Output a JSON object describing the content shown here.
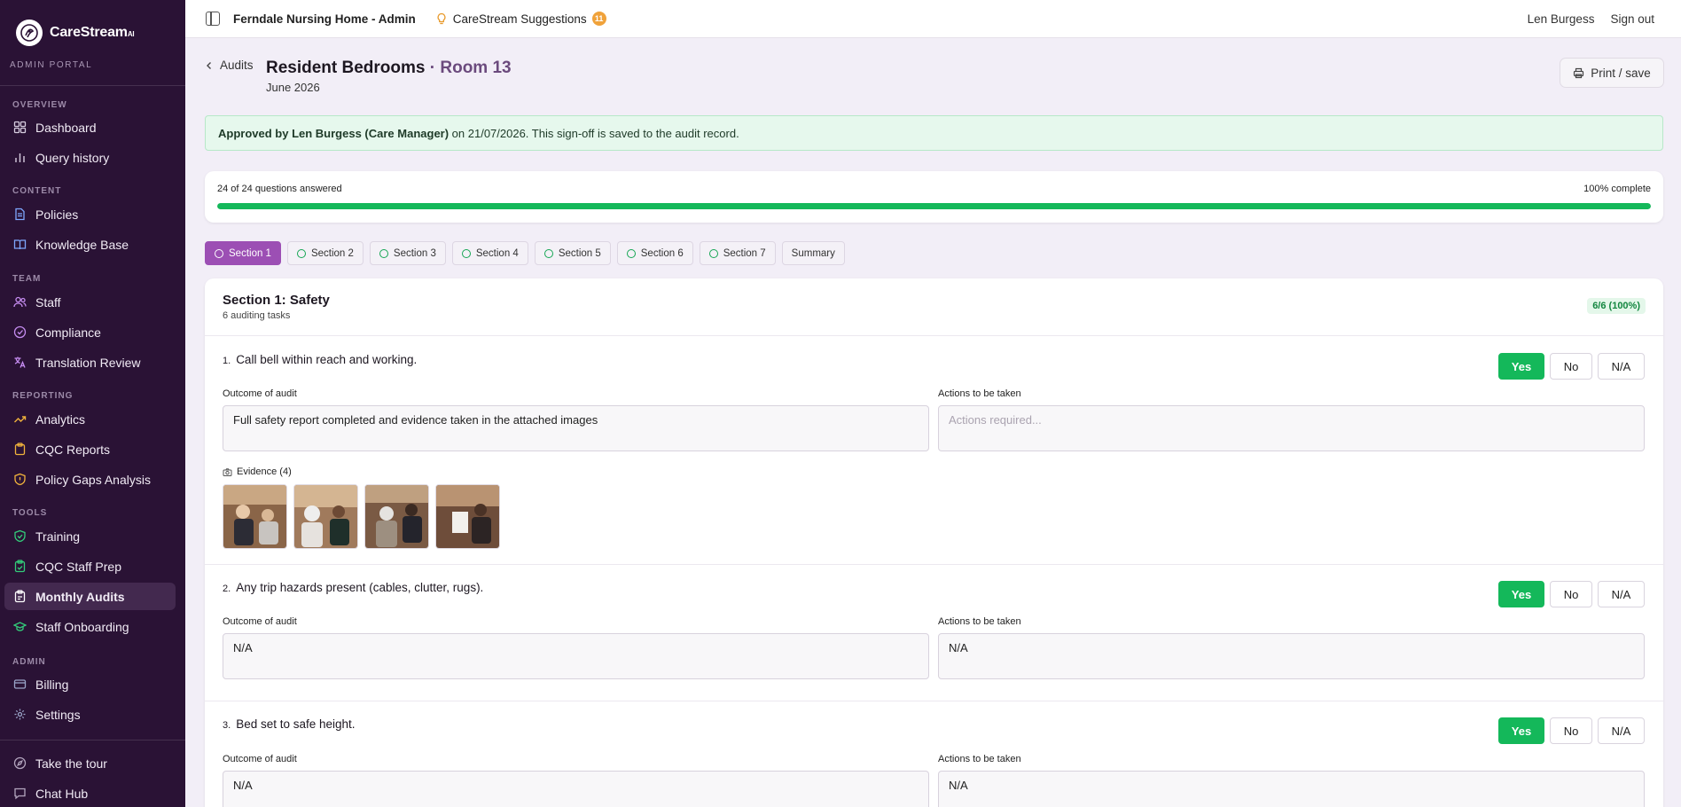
{
  "brand": {
    "name": "CareStream",
    "suffix": "AI",
    "portal": "ADMIN PORTAL"
  },
  "sidebar": {
    "sections": [
      {
        "label": "OVERVIEW",
        "items": [
          {
            "label": "Dashboard",
            "icon": "dashboard-icon"
          },
          {
            "label": "Query history",
            "icon": "bar-chart-icon"
          }
        ]
      },
      {
        "label": "CONTENT",
        "items": [
          {
            "label": "Policies",
            "icon": "document-icon"
          },
          {
            "label": "Knowledge Base",
            "icon": "book-icon"
          }
        ]
      },
      {
        "label": "TEAM",
        "items": [
          {
            "label": "Staff",
            "icon": "users-icon"
          },
          {
            "label": "Compliance",
            "icon": "check-circle-icon"
          },
          {
            "label": "Translation Review",
            "icon": "translate-icon"
          }
        ]
      },
      {
        "label": "REPORTING",
        "items": [
          {
            "label": "Analytics",
            "icon": "trend-icon"
          },
          {
            "label": "CQC Reports",
            "icon": "clipboard-icon"
          },
          {
            "label": "Policy Gaps Analysis",
            "icon": "warning-shield-icon"
          }
        ]
      },
      {
        "label": "TOOLS",
        "items": [
          {
            "label": "Training",
            "icon": "shield-check-icon"
          },
          {
            "label": "CQC Staff Prep",
            "icon": "clipboard-check-icon"
          },
          {
            "label": "Monthly Audits",
            "icon": "clipboard-list-icon",
            "active": true
          },
          {
            "label": "Staff Onboarding",
            "icon": "graduation-cap-icon"
          }
        ]
      },
      {
        "label": "ADMIN",
        "items": [
          {
            "label": "Billing",
            "icon": "credit-card-icon"
          },
          {
            "label": "Settings",
            "icon": "gear-icon"
          }
        ]
      }
    ],
    "footer": [
      {
        "label": "Take the tour",
        "icon": "compass-icon"
      },
      {
        "label": "Chat Hub",
        "icon": "chat-icon"
      }
    ]
  },
  "topbar": {
    "org": "Ferndale Nursing Home - Admin",
    "suggestions_label": "CareStream Suggestions",
    "suggestions_count": "11",
    "user": "Len Burgess",
    "signout": "Sign out"
  },
  "page": {
    "back_label": "Audits",
    "title": "Resident Bedrooms",
    "title_sep": " · ",
    "room": "Room 13",
    "subtitle": "June 2026",
    "print_label": "Print / save"
  },
  "approval": {
    "bold": "Approved by Len Burgess (Care Manager)",
    "rest": " on 21/07/2026. This sign-off is saved to the audit record."
  },
  "progress": {
    "answered": "24 of 24 questions answered",
    "complete": "100% complete",
    "fraction": 1.0
  },
  "tabs": [
    {
      "label": "Section 1",
      "active": true,
      "done": true
    },
    {
      "label": "Section 2",
      "done": true
    },
    {
      "label": "Section 3",
      "done": true
    },
    {
      "label": "Section 4",
      "done": true
    },
    {
      "label": "Section 5",
      "done": true
    },
    {
      "label": "Section 6",
      "done": true
    },
    {
      "label": "Section 7",
      "done": true
    },
    {
      "label": "Summary",
      "done": false
    }
  ],
  "section": {
    "title": "Section 1: Safety",
    "subtitle": "6 auditing tasks",
    "score": "6/6 (100%)",
    "outcome_label": "Outcome of audit",
    "actions_label": "Actions to be taken",
    "answer_options": {
      "yes": "Yes",
      "no": "No",
      "na": "N/A"
    },
    "questions": [
      {
        "num": "1.",
        "text": "Call bell within reach and working.",
        "outcome": "Full safety report completed and evidence taken in the attached images",
        "actions": "",
        "actions_placeholder": "Actions required...",
        "evidence_label": "Evidence (4)"
      },
      {
        "num": "2.",
        "text": "Any trip hazards present (cables, clutter, rugs).",
        "outcome": "N/A",
        "actions": "N/A"
      },
      {
        "num": "3.",
        "text": "Bed set to safe height.",
        "outcome": "N/A",
        "actions": "N/A"
      }
    ]
  },
  "colors": {
    "sidebar": "#2a1235",
    "accent": "#9c4fb4",
    "success": "#14b85a"
  }
}
